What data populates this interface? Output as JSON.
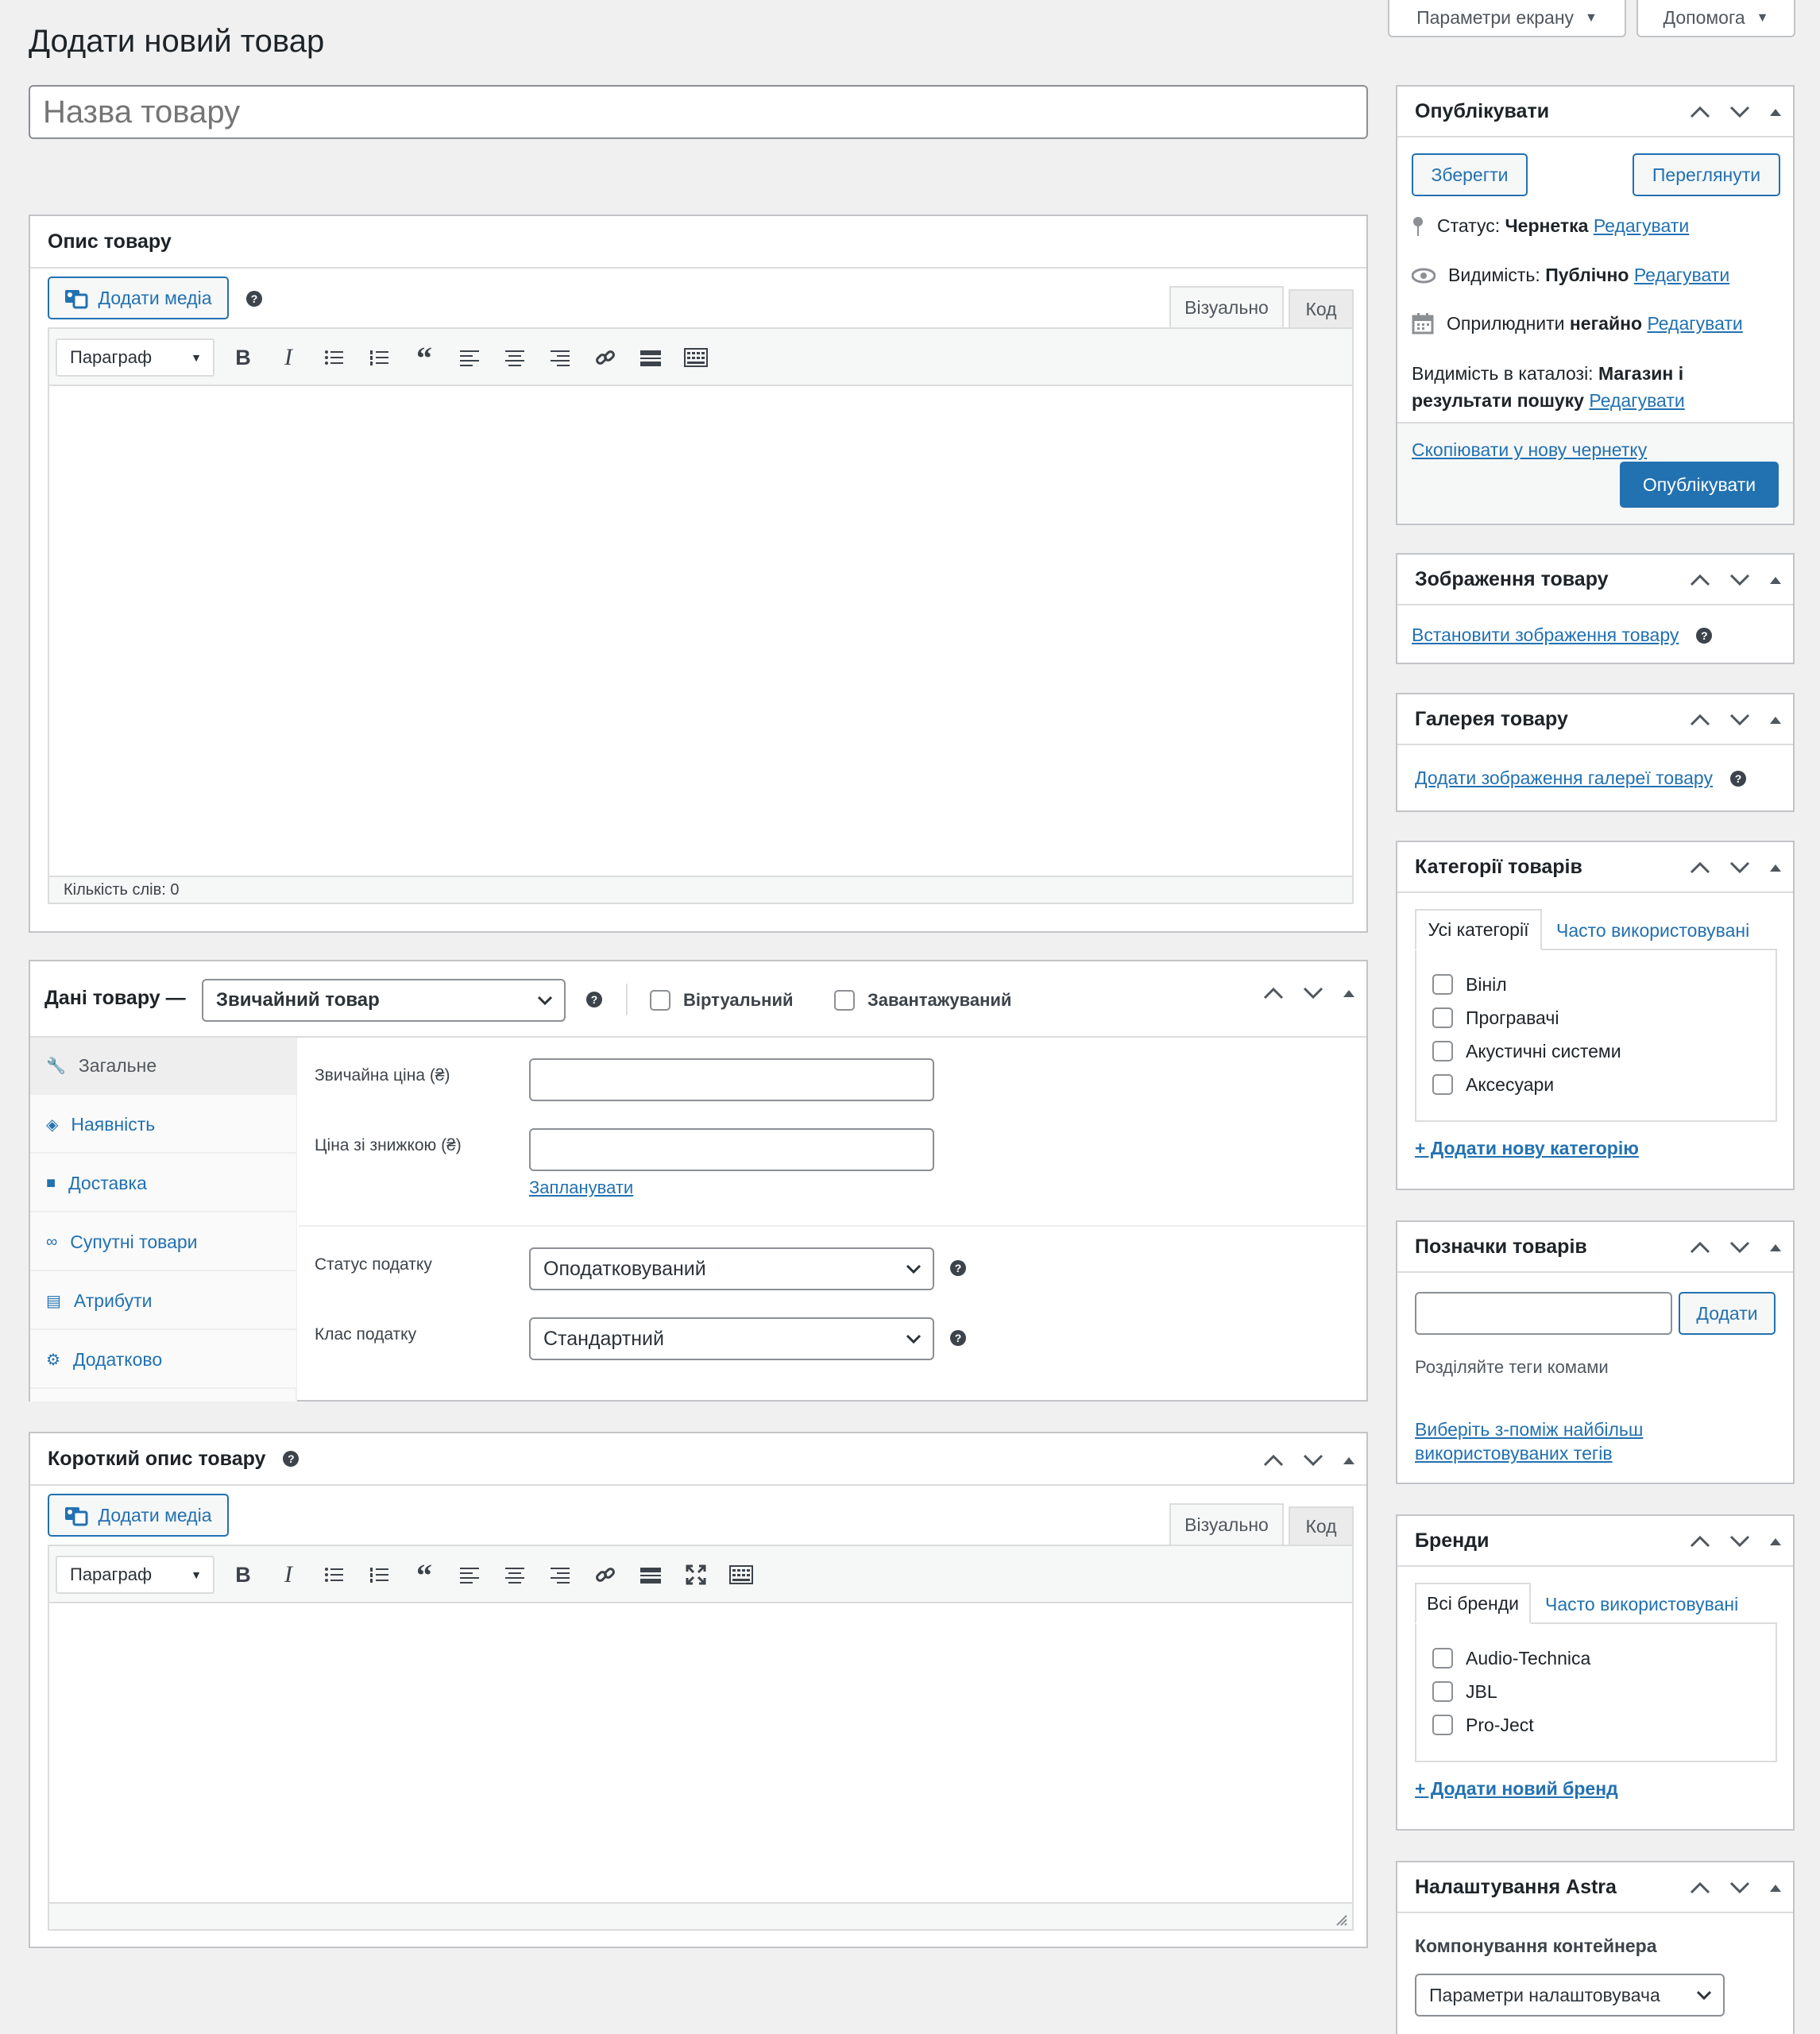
{
  "header": {
    "page_title": "Додати новий товар",
    "screen_options": "Параметри екрану",
    "help": "Допомога"
  },
  "title_input": {
    "placeholder": "Назва товару"
  },
  "description": {
    "heading": "Опис товару",
    "add_media": "Додати медіа",
    "tab_visual": "Візуально",
    "tab_code": "Код",
    "format": "Параграф",
    "word_count": "Кількість слів: 0"
  },
  "product_data": {
    "heading": "Дані товару —",
    "type": "Звичайний товар",
    "virtual": "Віртуальний",
    "downloadable": "Завантажуваний",
    "tabs": [
      "Загальне",
      "Наявність",
      "Доставка",
      "Супутні товари",
      "Атрибути",
      "Додатково"
    ],
    "regular_price": "Звичайна ціна (₴)",
    "sale_price": "Ціна зі знижкою (₴)",
    "schedule": "Запланувати",
    "tax_status_label": "Статус податку",
    "tax_status": "Оподатковуваний",
    "tax_class_label": "Клас податку",
    "tax_class": "Стандартний"
  },
  "short_description": {
    "heading": "Короткий опис товару",
    "add_media": "Додати медіа",
    "tab_visual": "Візуально",
    "tab_code": "Код",
    "format": "Параграф"
  },
  "publish": {
    "heading": "Опублікувати",
    "save": "Зберегти",
    "preview": "Переглянути",
    "status_label": "Статус:",
    "status_value": "Чернетка",
    "visibility_label": "Видимість:",
    "visibility_value": "Публічно",
    "publish_label": "Оприлюднити",
    "publish_value": "негайно",
    "edit": "Редагувати",
    "catalog_label": "Видимість в каталозі:",
    "catalog_value_1": "Магазин і",
    "catalog_value_2": "результати пошуку",
    "copy_draft": "Скопіювати у нову чернетку",
    "publish_btn": "Опублікувати"
  },
  "product_image": {
    "heading": "Зображення товару",
    "link": "Встановити зображення товару"
  },
  "gallery": {
    "heading": "Галерея товару",
    "link": "Додати зображення галереї товару"
  },
  "categories": {
    "heading": "Категорії товарів",
    "tab_all": "Усі категорії",
    "tab_popular": "Часто використовувані",
    "items": [
      "Вініл",
      "Програвачі",
      "Акустичні системи",
      "Аксесуари"
    ],
    "add": "+ Додати нову категорію"
  },
  "tags": {
    "heading": "Позначки товарів",
    "add": "Додати",
    "hint": "Розділяйте теги комами",
    "choose_1": "Виберіть з-поміж найбільш",
    "choose_2": "використовуваних тегів"
  },
  "brands": {
    "heading": "Бренди",
    "tab_all": "Всі бренди",
    "tab_popular": "Часто використовувані",
    "items": [
      "Audio-Technica",
      "JBL",
      "Pro-Ject"
    ],
    "add": "+ Додати новий бренд"
  },
  "astra": {
    "heading": "Налаштування Astra",
    "container_label": "Компонування контейнера",
    "container_value": "Параметри налаштовувача"
  }
}
